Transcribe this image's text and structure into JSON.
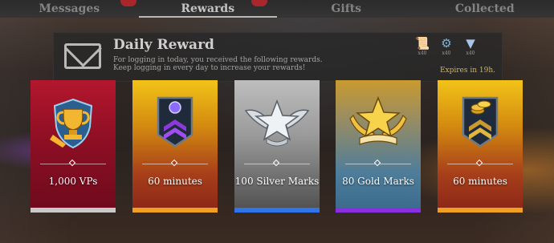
{
  "tabs": [
    {
      "label": "Messages",
      "active": false
    },
    {
      "label": "Rewards",
      "active": true
    },
    {
      "label": "Gifts",
      "active": false
    },
    {
      "label": "Collected",
      "active": false
    }
  ],
  "panel": {
    "title": "Daily Reward",
    "line1": "For logging in today, you received the following rewards.",
    "line2": "Keep logging in every day to increase your rewards!",
    "expires": "Expires in 19h."
  },
  "mini_icons": [
    {
      "icon": "scroll-icon",
      "label": "x40"
    },
    {
      "icon": "gear-medal-icon",
      "label": "x40"
    },
    {
      "icon": "wings-icon",
      "label": "x40"
    }
  ],
  "rewards": [
    {
      "label": "1,000 VPs",
      "icon": "trophy-shield-icon",
      "bar_color": "#c9c9c9"
    },
    {
      "label": "60 minutes",
      "icon": "purple-rank-banner-icon",
      "bar_color": "#f0a020"
    },
    {
      "label": "100 Silver Marks",
      "icon": "silver-winged-star-icon",
      "bar_color": "#2f74e8"
    },
    {
      "label": "80 Gold Marks",
      "icon": "gold-laurel-star-icon",
      "bar_color": "#8a2fe0"
    },
    {
      "label": "60 minutes",
      "icon": "gold-coin-banner-icon",
      "bar_color": "#f0a020"
    }
  ]
}
